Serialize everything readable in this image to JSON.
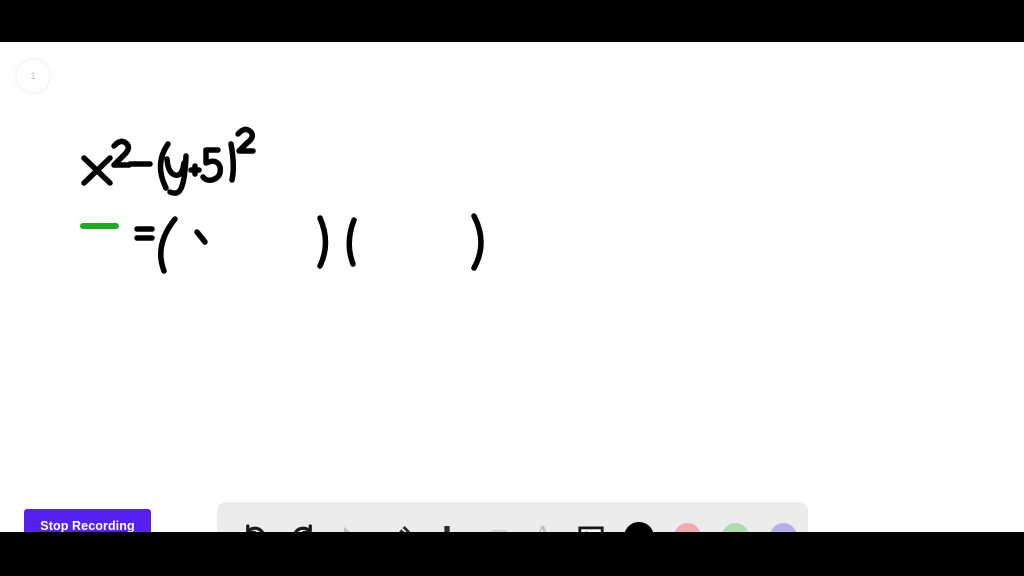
{
  "app": {
    "kind": "whiteboard-recording-app",
    "background_color": "#000000",
    "canvas_color": "#ffffff"
  },
  "page_badge": {
    "label": "1",
    "name": "page-number-badge"
  },
  "recording": {
    "stop_label": "Stop Recording",
    "button_color": "#5521f0",
    "text_color": "#ffffff"
  },
  "toolbar": {
    "background_color": "#ececec",
    "tools": [
      {
        "id": "undo",
        "icon": "undo-icon",
        "label": "Undo",
        "state": "enabled",
        "color": "#1a1a1a"
      },
      {
        "id": "redo",
        "icon": "redo-icon",
        "label": "Redo",
        "state": "enabled",
        "color": "#1a1a1a"
      },
      {
        "id": "select",
        "icon": "cursor-icon",
        "label": "Select",
        "state": "disabled",
        "color": "#c2c2c2"
      },
      {
        "id": "pen",
        "icon": "pencil-icon",
        "label": "Pen",
        "state": "active",
        "color": "#2b2b2b"
      },
      {
        "id": "add",
        "icon": "plus-icon",
        "label": "Add Page",
        "state": "enabled",
        "color": "#2b2b2b"
      },
      {
        "id": "eraser",
        "icon": "eraser-icon",
        "label": "Eraser",
        "state": "disabled",
        "color": "#d2d2d2"
      },
      {
        "id": "text",
        "icon": "text-a-icon",
        "label": "Text",
        "state": "disabled",
        "color": "#bdbdbd"
      },
      {
        "id": "image",
        "icon": "image-icon",
        "label": "Insert Image",
        "state": "enabled",
        "color": "#1a1a1a"
      }
    ],
    "colors": [
      {
        "id": "black",
        "name": "color-swatch-black",
        "hex": "#000000",
        "selected": true
      },
      {
        "id": "pink",
        "name": "color-swatch-pink",
        "hex": "#f2aab0",
        "selected": false
      },
      {
        "id": "green",
        "name": "color-swatch-green",
        "hex": "#aedcae",
        "selected": false
      },
      {
        "id": "purple",
        "name": "color-swatch-purple",
        "hex": "#b3b0ea",
        "selected": false
      }
    ]
  },
  "ink": {
    "description": "Handwritten algebra: difference of squares factoring setup",
    "stroke_color": "#000000",
    "highlight_color": "#22aa22",
    "lines": [
      {
        "id": "line1",
        "text": "x² − (y + 5)²",
        "underline_color": "#22aa22",
        "underline_under": "x²"
      },
      {
        "id": "line2",
        "text": "= (   )(      )"
      }
    ]
  }
}
